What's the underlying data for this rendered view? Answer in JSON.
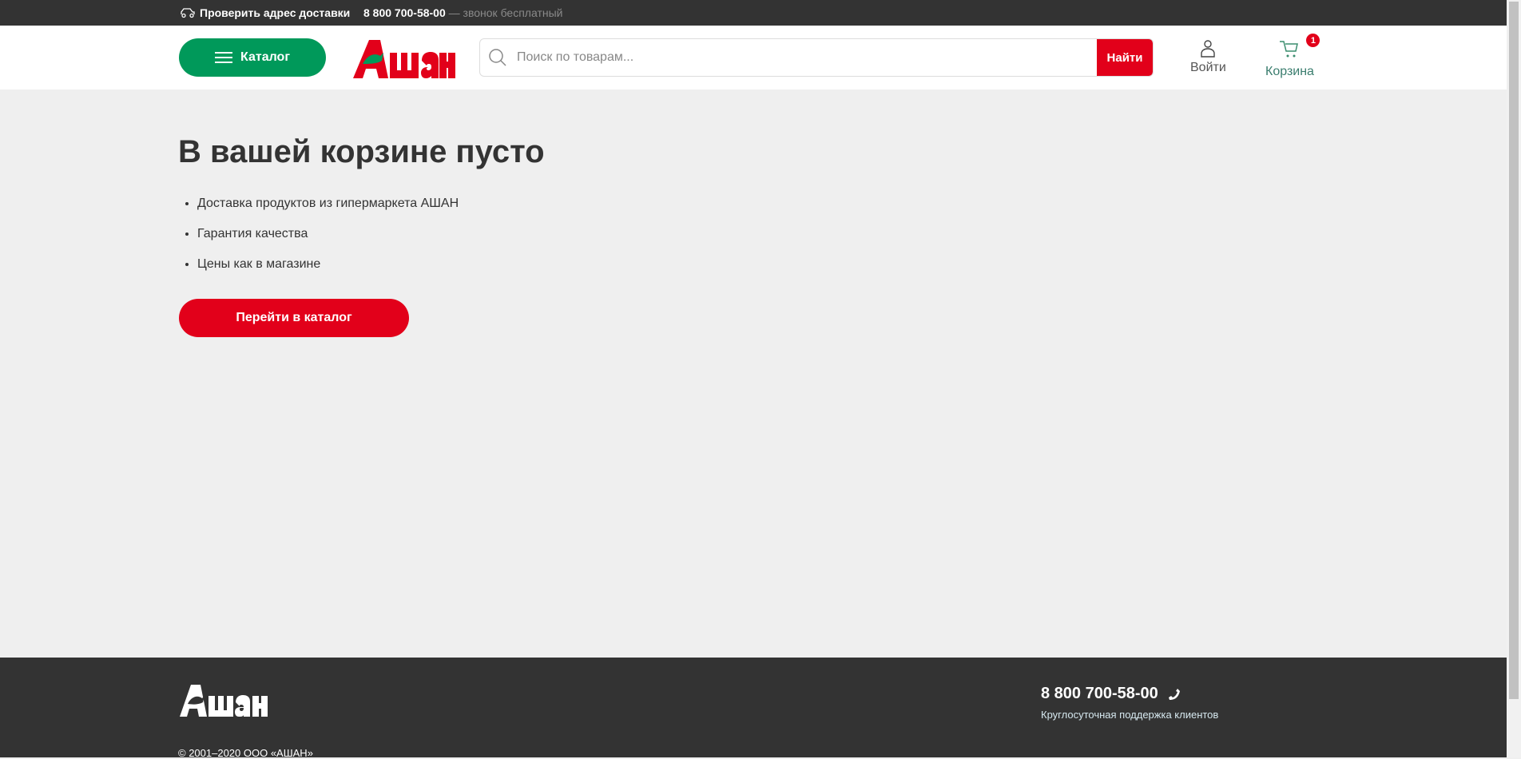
{
  "topbar": {
    "address_label": "Проверить адрес доставки",
    "phone": "8 800 700-58-00",
    "phone_note": "— звонок бесплатный"
  },
  "header": {
    "catalog_label": "Каталог",
    "logo_text": "Ашан",
    "search_placeholder": "Поиск по товарам...",
    "search_button": "Найти",
    "login_label": "Войти",
    "cart_label": "Корзина",
    "cart_count": "1"
  },
  "main": {
    "title": "В вашей корзине пусто",
    "benefits": [
      "Доставка продуктов из гипермаркета АШАН",
      "Гарантия качества",
      "Цены как в магазине"
    ],
    "cta_label": "Перейти в каталог"
  },
  "footer": {
    "logo_text": "Ашан",
    "phone": "8 800 700-58-00",
    "support": "Круглосуточная поддержка клиентов",
    "copyright": "© 2001–2020 ООО «АШАН»"
  },
  "colors": {
    "brand_red": "#e2001a",
    "brand_green": "#00995a",
    "dark": "#333333"
  }
}
